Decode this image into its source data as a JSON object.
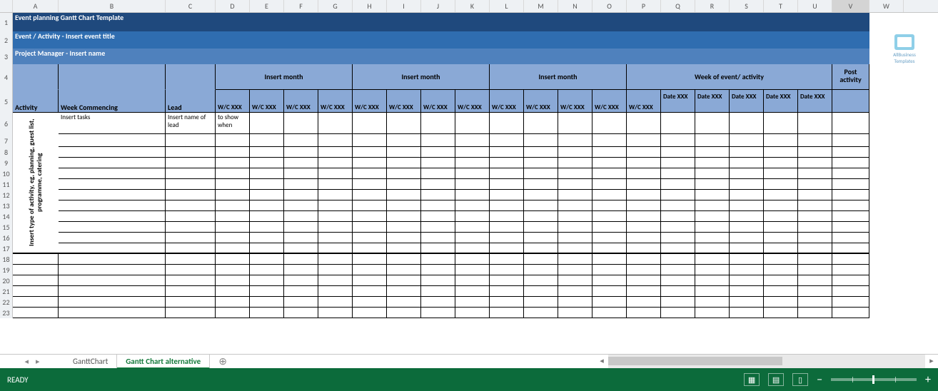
{
  "columns": [
    "A",
    "B",
    "C",
    "D",
    "E",
    "F",
    "G",
    "H",
    "I",
    "J",
    "K",
    "L",
    "M",
    "N",
    "O",
    "P",
    "Q",
    "R",
    "S",
    "T",
    "U",
    "V",
    "W"
  ],
  "row_numbers": [
    "1",
    "2",
    "3",
    "4",
    "5",
    "6",
    "7",
    "8",
    "9",
    "10",
    "11",
    "12",
    "13",
    "14",
    "15",
    "16",
    "17",
    "18",
    "19",
    "20",
    "21",
    "22",
    "23"
  ],
  "titles": {
    "main": "Event planning Gantt Chart Template",
    "event": "Event / Activity - Insert event title",
    "pm": "Project Manager -  Insert name"
  },
  "headers": {
    "activity": "Activity",
    "week_commencing": "Week Commencing",
    "lead": "Lead",
    "month_groups": [
      "Insert month",
      "Insert month",
      "Insert month",
      "Week of event/ activity"
    ],
    "post_activity": "Post activity",
    "wc_label": "W/C XXX",
    "date_label": "Date XXX"
  },
  "sample": {
    "vertical_activity": "Insert type of activity, eg, planning, guest list, programme, catering",
    "tasks": "Insert tasks",
    "lead_name": "Insert name of lead",
    "show_when": "to show when"
  },
  "watermark": "AllBusiness Templates",
  "tabs": {
    "inactive": "GanttChart",
    "active": "Gantt Chart alternative",
    "add": "⊕"
  },
  "status": {
    "ready": "READY",
    "minus": "−",
    "plus": "+"
  },
  "arrows": {
    "left": "◂",
    "right": "▸",
    "first": "|◂",
    "last": "▸|"
  },
  "active_col": "V"
}
